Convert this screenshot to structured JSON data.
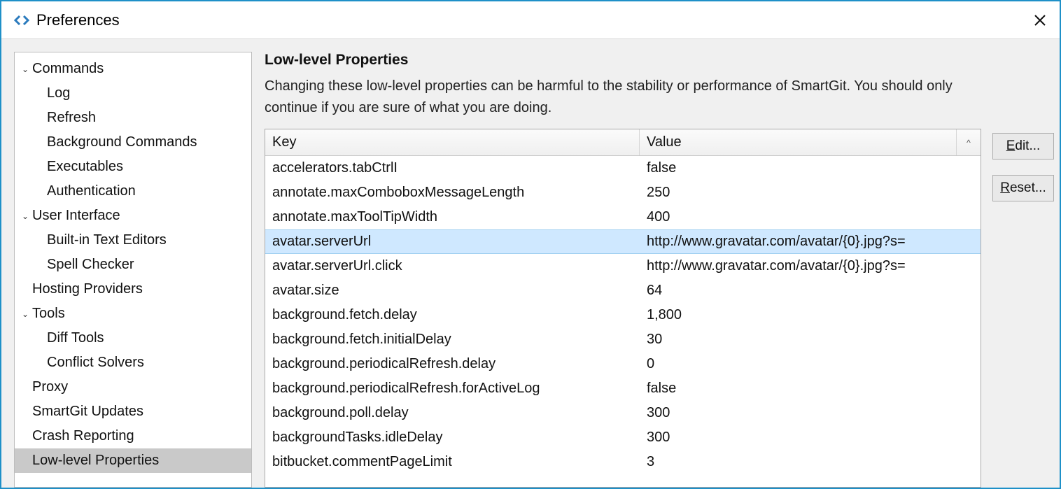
{
  "window": {
    "title": "Preferences"
  },
  "sidebar": {
    "items": [
      {
        "label": "Commands",
        "level": 0,
        "expandable": true
      },
      {
        "label": "Log",
        "level": 1
      },
      {
        "label": "Refresh",
        "level": 1
      },
      {
        "label": "Background Commands",
        "level": 1
      },
      {
        "label": "Executables",
        "level": 1
      },
      {
        "label": "Authentication",
        "level": 1
      },
      {
        "label": "User Interface",
        "level": 0,
        "expandable": true
      },
      {
        "label": "Built-in Text Editors",
        "level": 1
      },
      {
        "label": "Spell Checker",
        "level": 1
      },
      {
        "label": "Hosting Providers",
        "level": 0
      },
      {
        "label": "Tools",
        "level": 0,
        "expandable": true
      },
      {
        "label": "Diff Tools",
        "level": 1
      },
      {
        "label": "Conflict Solvers",
        "level": 1
      },
      {
        "label": "Proxy",
        "level": 0
      },
      {
        "label": "SmartGit Updates",
        "level": 0
      },
      {
        "label": "Crash Reporting",
        "level": 0
      },
      {
        "label": "Low-level Properties",
        "level": 0,
        "selected": true
      }
    ]
  },
  "main": {
    "heading": "Low-level Properties",
    "description": "Changing these low-level properties can be harmful to the stability or performance of SmartGit. You should only continue if you are sure of what you are doing.",
    "columns": {
      "key": "Key",
      "value": "Value",
      "sort_indicator": "^"
    },
    "rows": [
      {
        "key": "accelerators.tabCtrlI",
        "value": "false"
      },
      {
        "key": "annotate.maxComboboxMessageLength",
        "value": "250"
      },
      {
        "key": "annotate.maxToolTipWidth",
        "value": "400"
      },
      {
        "key": "avatar.serverUrl",
        "value": "http://www.gravatar.com/avatar/{0}.jpg?s=",
        "selected": true
      },
      {
        "key": "avatar.serverUrl.click",
        "value": "http://www.gravatar.com/avatar/{0}.jpg?s="
      },
      {
        "key": "avatar.size",
        "value": "64"
      },
      {
        "key": "background.fetch.delay",
        "value": "1,800"
      },
      {
        "key": "background.fetch.initialDelay",
        "value": "30"
      },
      {
        "key": "background.periodicalRefresh.delay",
        "value": "0"
      },
      {
        "key": "background.periodicalRefresh.forActiveLog",
        "value": "false"
      },
      {
        "key": "background.poll.delay",
        "value": "300"
      },
      {
        "key": "backgroundTasks.idleDelay",
        "value": "300"
      },
      {
        "key": "bitbucket.commentPageLimit",
        "value": "3"
      }
    ]
  },
  "buttons": {
    "edit_accel": "E",
    "edit_rest": "dit...",
    "reset_accel": "R",
    "reset_rest": "eset..."
  }
}
